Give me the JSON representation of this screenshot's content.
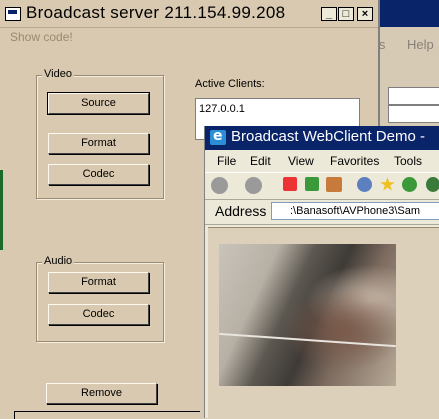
{
  "server_window": {
    "title": "Broadcast server 211.154.99.208",
    "menu": "Show code!",
    "video_group": {
      "label": "Video",
      "source_button": "Source",
      "format_button": "Format",
      "codec_button": "Codec"
    },
    "audio_group": {
      "label": "Audio",
      "format_button": "Format",
      "codec_button": "Codec"
    },
    "active_clients_label": "Active Clients:",
    "active_clients": [
      "127.0.0.1"
    ],
    "remove_button": "Remove",
    "caption_buttons": {
      "minimize": "_",
      "maximize": "□",
      "close": "×"
    }
  },
  "background_window": {
    "menu": [
      "ls",
      "Help"
    ]
  },
  "browser_window": {
    "title": "Broadcast WebClient Demo -",
    "menu": [
      "File",
      "Edit",
      "View",
      "Favorites",
      "Tools"
    ],
    "address_label": "Address",
    "address_value": ":\\Banasoft\\AVPhone3\\Sam"
  },
  "colors": {
    "window_face": "#d9c9b0",
    "ie_titlebar": "#0a246a",
    "ie_face": "#ece9d8"
  }
}
